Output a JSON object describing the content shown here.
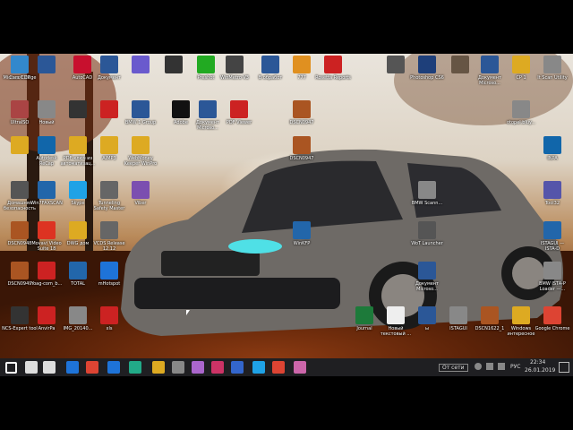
{
  "desktop_icons": [
    {
      "label": "Microsoft Edge",
      "color": "#1e73d8"
    },
    {
      "label": "",
      "color": "#2b5797"
    },
    {
      "label": "AutoCAD",
      "color": "#c8102e"
    },
    {
      "label": "Документ",
      "color": "#2b5797"
    },
    {
      "label": "",
      "color": "#6a5acd"
    },
    {
      "label": "",
      "color": "#333333"
    },
    {
      "label": "Preshot",
      "color": "#22aa22"
    },
    {
      "label": "WinMetro V3",
      "color": "#444444"
    },
    {
      "label": "В обработ",
      "color": "#2b5797"
    },
    {
      "label": "777",
      "color": "#e09020"
    },
    {
      "label": "Rosetta Reports",
      "color": "#cc2222"
    },
    {
      "label": "",
      "color": "#555555"
    },
    {
      "label": "Photoshop CS6",
      "color": "#1e3f7a"
    },
    {
      "label": "",
      "color": "#665544"
    },
    {
      "label": "Документ Microso...",
      "color": "#2b5797"
    },
    {
      "label": "CP 1",
      "color": "#ddaa22"
    },
    {
      "label": "It Scan Utility",
      "color": "#888888"
    },
    {
      "label": "UltraISO",
      "color": "#aa4444"
    },
    {
      "label": "Новый",
      "color": "#888888"
    },
    {
      "label": "",
      "color": "#333333"
    },
    {
      "label": "",
      "color": "#cc2222"
    },
    {
      "label": "BMW 1 Group",
      "color": "#2b5797"
    },
    {
      "label": "Adobe",
      "color": "#111111"
    },
    {
      "label": "Документ Microso...",
      "color": "#2b5797"
    },
    {
      "label": "PDF Viewer",
      "color": "#cc2222"
    },
    {
      "label": "DSCN0947",
      "color": "#aa5522"
    },
    {
      "label": "otopel.bluy...",
      "color": "#888888"
    },
    {
      "label": "",
      "color": "#ddaa22"
    },
    {
      "label": "Autodesk ReCap",
      "color": "#1166aa"
    },
    {
      "label": "PDF-ключ из автоматизац...",
      "color": "#ddaa22"
    },
    {
      "label": "AIMP3",
      "color": "#ddaa22"
    },
    {
      "label": "WebMoney Keeper WinPro",
      "color": "#ddaa22"
    },
    {
      "label": "DSCN0947",
      "color": "#aa5522"
    },
    {
      "label": "INPA",
      "color": "#1166aa"
    },
    {
      "label": "Домашняя безопасность",
      "color": "#555555"
    },
    {
      "label": "Win7FAXSCAN",
      "color": "#2266aa"
    },
    {
      "label": "Skype",
      "color": "#1fa2e6"
    },
    {
      "label": "Tunneling Safety Master",
      "color": "#666666"
    },
    {
      "label": "Viber",
      "color": "#7b4fb0"
    },
    {
      "label": "BMW Scann...",
      "color": "#888888"
    },
    {
      "label": "Tool32",
      "color": "#5555aa"
    },
    {
      "label": "DSCN0948",
      "color": "#aa5522"
    },
    {
      "label": "Movavi Video Suite 18",
      "color": "#dd3322"
    },
    {
      "label": "DWG дом",
      "color": "#ddaa22"
    },
    {
      "label": "VCDS Release 12.12",
      "color": "#666666"
    },
    {
      "label": "WoT Launcher",
      "color": "#555555"
    },
    {
      "label": "ISTAGUI — ISTA-D",
      "color": "#2266aa"
    },
    {
      "label": "WinKFP",
      "color": "#2266aa"
    },
    {
      "label": "DSCN0949",
      "color": "#aa5522"
    },
    {
      "label": "Yoag-com_b...",
      "color": "#cc2222"
    },
    {
      "label": "TOTAL",
      "color": "#2266aa"
    },
    {
      "label": "mHotspot",
      "color": "#1e73d8"
    },
    {
      "label": "Документ Microso...",
      "color": "#2b5797"
    },
    {
      "label": "BMW ISTA-P Loader —...",
      "color": "#888888"
    },
    {
      "label": "NCS-Expert tool",
      "color": "#333333"
    },
    {
      "label": "AnvirPa",
      "color": "#cc2222"
    },
    {
      "label": "IMG_20140...",
      "color": "#888888"
    },
    {
      "label": "xls",
      "color": "#cc2222"
    },
    {
      "label": "Journal",
      "color": "#1d7a3a"
    },
    {
      "label": "Новый текстовый ...",
      "color": "#eeeeee"
    },
    {
      "label": "ы",
      "color": "#2b5797"
    },
    {
      "label": "ISTAGUI",
      "color": "#888888"
    },
    {
      "label": "DSCN1622_1",
      "color": "#aa5522"
    },
    {
      "label": "Windows интересное",
      "color": "#ddaa22"
    },
    {
      "label": "Google Chrome",
      "color": "#dd4433"
    },
    {
      "label": "Cars CDP",
      "color": "#3388cc"
    }
  ],
  "taskbar": {
    "network_label": "От сети",
    "language": "РУС",
    "time": "22:34",
    "date": "26.01.2019"
  },
  "taskbar_apps": [
    {
      "name": "start",
      "color": "#ffffff"
    },
    {
      "name": "search",
      "color": "#dddddd"
    },
    {
      "name": "task-view",
      "color": "#dddddd"
    },
    {
      "name": "mail",
      "color": "#1e73d8"
    },
    {
      "name": "chrome",
      "color": "#dd4433"
    },
    {
      "name": "edge",
      "color": "#1e73d8"
    },
    {
      "name": "app-a",
      "color": "#22aa88"
    },
    {
      "name": "explorer",
      "color": "#ddaa22"
    },
    {
      "name": "app-b",
      "color": "#888888"
    },
    {
      "name": "app-c",
      "color": "#aa66cc"
    },
    {
      "name": "app-d",
      "color": "#cc3366"
    },
    {
      "name": "save",
      "color": "#3366cc"
    },
    {
      "name": "skype",
      "color": "#1fa2e6"
    },
    {
      "name": "app-e",
      "color": "#dd4433"
    },
    {
      "name": "app-f",
      "color": "#cc66aa"
    }
  ]
}
